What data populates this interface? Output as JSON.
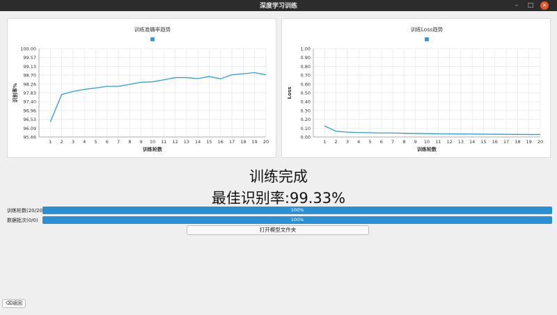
{
  "window": {
    "title": "深度学习训练",
    "minimize_glyph": "–",
    "maximize_glyph": "□",
    "close_glyph": "✕"
  },
  "status": {
    "title": "训练完成",
    "best_rate": "最佳识别率:99.33%"
  },
  "progress": [
    {
      "label": "训练轮数(20/20)",
      "text": "100%",
      "fraction": 1.0
    },
    {
      "label": "数据批次(0/0)",
      "text": "100%",
      "fraction": 1.0
    }
  ],
  "buttons": {
    "open_folder": "打开模型文件夹",
    "back": "⌫返回"
  },
  "colors": {
    "line": "#2a9fd6",
    "progress": "#2b8fd3",
    "grid": "#e6e6e6"
  },
  "chart_data": [
    {
      "type": "line",
      "title": "训练准确率趋势",
      "xlabel": "训练轮数",
      "ylabel": "识别率%",
      "x": [
        1,
        2,
        3,
        4,
        5,
        6,
        7,
        8,
        9,
        10,
        11,
        12,
        13,
        14,
        15,
        16,
        17,
        18,
        19,
        20
      ],
      "x_ticks": [
        "1",
        "2",
        "3",
        "4",
        "5",
        "6",
        "7",
        "8",
        "9",
        "10",
        "11",
        "12",
        "13",
        "14",
        "15",
        "16",
        "17",
        "18",
        "19",
        "20"
      ],
      "y_ticks": [
        "95.66",
        "96.09",
        "96.53",
        "96.96",
        "97.40",
        "97.83",
        "98.26",
        "98.70",
        "99.13",
        "99.57",
        "100.00"
      ],
      "ylim": [
        95.66,
        100.0
      ],
      "xlim": [
        0,
        20
      ],
      "series": [
        {
          "values": [
            96.4,
            97.75,
            97.9,
            98.0,
            98.07,
            98.15,
            98.15,
            98.25,
            98.35,
            98.37,
            98.47,
            98.58,
            98.58,
            98.53,
            98.63,
            98.52,
            98.72,
            98.77,
            98.82,
            98.72
          ]
        }
      ],
      "legend": "top-center",
      "grid": true
    },
    {
      "type": "line",
      "title": "训练Loss趋势",
      "xlabel": "训练轮数",
      "ylabel": "Loss",
      "x": [
        1,
        2,
        3,
        4,
        5,
        6,
        7,
        8,
        9,
        10,
        11,
        12,
        13,
        14,
        15,
        16,
        17,
        18,
        19,
        20
      ],
      "x_ticks": [
        "1",
        "2",
        "3",
        "4",
        "5",
        "6",
        "7",
        "8",
        "9",
        "10",
        "11",
        "12",
        "13",
        "14",
        "15",
        "16",
        "17",
        "18",
        "19",
        "20"
      ],
      "y_ticks": [
        "0.00",
        "0.10",
        "0.20",
        "0.30",
        "0.40",
        "0.50",
        "0.60",
        "0.70",
        "0.80",
        "0.90",
        "1.00"
      ],
      "ylim": [
        0.0,
        1.0
      ],
      "xlim": [
        0,
        20
      ],
      "series": [
        {
          "values": [
            0.125,
            0.065,
            0.055,
            0.05,
            0.048,
            0.045,
            0.045,
            0.042,
            0.04,
            0.038,
            0.036,
            0.035,
            0.034,
            0.033,
            0.032,
            0.031,
            0.03,
            0.029,
            0.028,
            0.028
          ]
        }
      ],
      "legend": "top-center",
      "grid": true
    }
  ]
}
